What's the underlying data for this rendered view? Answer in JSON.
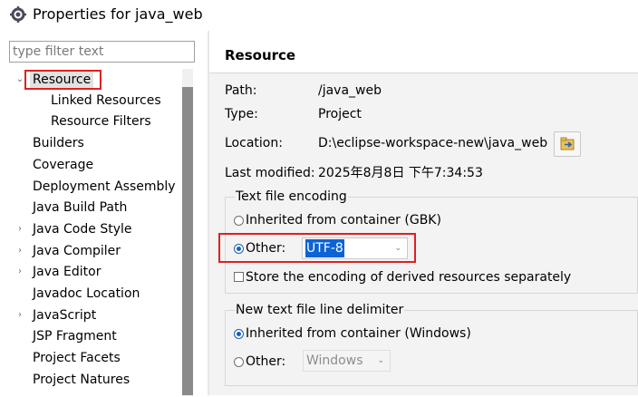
{
  "window": {
    "title": "Properties for java_web"
  },
  "filter": {
    "placeholder": "type filter text"
  },
  "tree": {
    "items": [
      {
        "label": "Resource",
        "expandable": true,
        "expanded": true,
        "selected": true
      },
      {
        "label": "Linked Resources",
        "child": true
      },
      {
        "label": "Resource Filters",
        "child": true
      },
      {
        "label": "Builders"
      },
      {
        "label": "Coverage"
      },
      {
        "label": "Deployment Assembly"
      },
      {
        "label": "Java Build Path"
      },
      {
        "label": "Java Code Style",
        "expandable": true
      },
      {
        "label": "Java Compiler",
        "expandable": true
      },
      {
        "label": "Java Editor",
        "expandable": true
      },
      {
        "label": "Javadoc Location"
      },
      {
        "label": "JavaScript",
        "expandable": true
      },
      {
        "label": "JSP Fragment"
      },
      {
        "label": "Project Facets"
      },
      {
        "label": "Project Natures"
      }
    ]
  },
  "page": {
    "title": "Resource",
    "path_label": "Path:",
    "path_value": "/java_web",
    "type_label": "Type:",
    "type_value": "Project",
    "location_label": "Location:",
    "location_value": "D:\\eclipse-workspace-new\\java_web",
    "last_modified_label": "Last modified:",
    "last_modified_value": "2025年8月8日 下午7:34:53"
  },
  "encoding": {
    "group_title": "Text file encoding",
    "inherited_label": "Inherited from container (GBK)",
    "inherited_selected": false,
    "other_label": "Other:",
    "other_selected": true,
    "other_value": "UTF-8",
    "derived_checkbox_label": "Store the encoding of derived resources separately",
    "derived_checked": false
  },
  "line_delimiter": {
    "group_title": "New text file line delimiter",
    "inherited_label": "Inherited from container (Windows)",
    "inherited_selected": true,
    "other_label": "Other:",
    "other_selected": false,
    "other_value": "Windows"
  },
  "colors": {
    "selection": "#0b63d6",
    "highlight_border": "#e02020",
    "radio_checked": "#1a5fb4"
  },
  "icons": {
    "app": "eclipse-gear-icon",
    "open_location": "folder-arrow-icon"
  }
}
